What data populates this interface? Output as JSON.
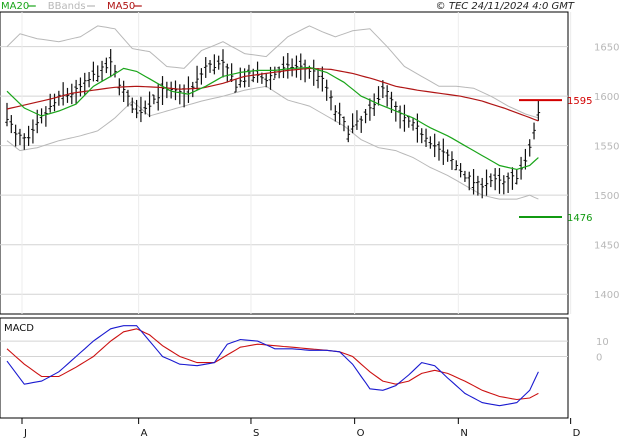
{
  "header": {
    "legend": [
      {
        "label": "MA20",
        "color": "#1aa51a"
      },
      {
        "label": "BBands",
        "color": "#b8b8b8"
      },
      {
        "label": "MA50",
        "color": "#b01515"
      }
    ],
    "credit": "© TEC 24/11/2024 4:0 GMT"
  },
  "chart_data": [
    {
      "type": "line",
      "name": "price",
      "ylim": [
        1380,
        1685
      ],
      "yticks": [
        1400,
        1450,
        1500,
        1550,
        1600,
        1650
      ],
      "xticks": [
        "J",
        "A",
        "S",
        "O",
        "N",
        "D"
      ],
      "xtick_index": [
        0,
        27,
        53,
        77,
        101,
        127
      ],
      "n_points": 128,
      "grid": true,
      "price_markers": [
        {
          "label": "1595",
          "value": 1596,
          "color": "#d20000"
        },
        {
          "label": "1476",
          "value": 1478,
          "color": "#119a11"
        }
      ],
      "price_keys": [
        [
          0,
          1580
        ],
        [
          2,
          1560
        ],
        [
          5,
          1555
        ],
        [
          8,
          1578
        ],
        [
          12,
          1598
        ],
        [
          16,
          1605
        ],
        [
          20,
          1620
        ],
        [
          24,
          1632
        ],
        [
          27,
          1605
        ],
        [
          30,
          1582
        ],
        [
          33,
          1593
        ],
        [
          36,
          1605
        ],
        [
          40,
          1603
        ],
        [
          43,
          1608
        ],
        [
          46,
          1630
        ],
        [
          50,
          1632
        ],
        [
          53,
          1612
        ],
        [
          56,
          1620
        ],
        [
          60,
          1618
        ],
        [
          63,
          1625
        ],
        [
          66,
          1630
        ],
        [
          69,
          1628
        ],
        [
          72,
          1622
        ],
        [
          74,
          1608
        ],
        [
          76,
          1585
        ],
        [
          79,
          1565
        ],
        [
          82,
          1575
        ],
        [
          85,
          1590
        ],
        [
          87,
          1610
        ],
        [
          89,
          1595
        ],
        [
          91,
          1580
        ],
        [
          94,
          1570
        ],
        [
          97,
          1560
        ],
        [
          100,
          1545
        ],
        [
          103,
          1535
        ],
        [
          106,
          1520
        ],
        [
          109,
          1510
        ],
        [
          112,
          1515
        ],
        [
          115,
          1512
        ],
        [
          118,
          1520
        ],
        [
          120,
          1532
        ],
        [
          123,
          1582
        ]
      ],
      "ma20_keys": [
        [
          0,
          1605
        ],
        [
          4,
          1588
        ],
        [
          8,
          1580
        ],
        [
          12,
          1585
        ],
        [
          16,
          1592
        ],
        [
          20,
          1610
        ],
        [
          24,
          1620
        ],
        [
          27,
          1628
        ],
        [
          30,
          1625
        ],
        [
          34,
          1615
        ],
        [
          38,
          1605
        ],
        [
          42,
          1602
        ],
        [
          46,
          1610
        ],
        [
          50,
          1620
        ],
        [
          54,
          1624
        ],
        [
          58,
          1626
        ],
        [
          62,
          1626
        ],
        [
          66,
          1628
        ],
        [
          70,
          1629
        ],
        [
          74,
          1624
        ],
        [
          78,
          1614
        ],
        [
          82,
          1600
        ],
        [
          86,
          1592
        ],
        [
          90,
          1585
        ],
        [
          94,
          1578
        ],
        [
          98,
          1568
        ],
        [
          102,
          1560
        ],
        [
          106,
          1550
        ],
        [
          110,
          1540
        ],
        [
          114,
          1530
        ],
        [
          118,
          1526
        ],
        [
          121,
          1530
        ],
        [
          123,
          1538
        ]
      ],
      "ma50_keys": [
        [
          0,
          1587
        ],
        [
          5,
          1592
        ],
        [
          10,
          1597
        ],
        [
          15,
          1603
        ],
        [
          20,
          1606
        ],
        [
          25,
          1609
        ],
        [
          30,
          1610
        ],
        [
          35,
          1609
        ],
        [
          40,
          1607
        ],
        [
          45,
          1608
        ],
        [
          50,
          1613
        ],
        [
          55,
          1620
        ],
        [
          60,
          1623
        ],
        [
          65,
          1626
        ],
        [
          70,
          1628
        ],
        [
          75,
          1627
        ],
        [
          80,
          1623
        ],
        [
          85,
          1617
        ],
        [
          90,
          1610
        ],
        [
          95,
          1606
        ],
        [
          100,
          1603
        ],
        [
          105,
          1600
        ],
        [
          110,
          1595
        ],
        [
          115,
          1588
        ],
        [
          120,
          1580
        ],
        [
          123,
          1575
        ]
      ],
      "bb_upper_keys": [
        [
          0,
          1650
        ],
        [
          3,
          1663
        ],
        [
          7,
          1658
        ],
        [
          12,
          1655
        ],
        [
          17,
          1660
        ],
        [
          21,
          1671
        ],
        [
          25,
          1668
        ],
        [
          29,
          1648
        ],
        [
          33,
          1645
        ],
        [
          37,
          1630
        ],
        [
          41,
          1628
        ],
        [
          45,
          1646
        ],
        [
          50,
          1655
        ],
        [
          55,
          1643
        ],
        [
          60,
          1640
        ],
        [
          65,
          1660
        ],
        [
          70,
          1671
        ],
        [
          73,
          1665
        ],
        [
          76,
          1660
        ],
        [
          80,
          1666
        ],
        [
          84,
          1668
        ],
        [
          88,
          1650
        ],
        [
          92,
          1630
        ],
        [
          96,
          1620
        ],
        [
          100,
          1610
        ],
        [
          104,
          1610
        ],
        [
          108,
          1608
        ],
        [
          112,
          1600
        ],
        [
          116,
          1590
        ],
        [
          120,
          1582
        ],
        [
          123,
          1578
        ]
      ],
      "bb_lower_keys": [
        [
          0,
          1555
        ],
        [
          3,
          1545
        ],
        [
          7,
          1548
        ],
        [
          12,
          1555
        ],
        [
          17,
          1560
        ],
        [
          21,
          1565
        ],
        [
          25,
          1578
        ],
        [
          29,
          1595
        ],
        [
          33,
          1580
        ],
        [
          37,
          1585
        ],
        [
          41,
          1590
        ],
        [
          45,
          1595
        ],
        [
          50,
          1600
        ],
        [
          55,
          1606
        ],
        [
          60,
          1610
        ],
        [
          65,
          1596
        ],
        [
          70,
          1590
        ],
        [
          74,
          1580
        ],
        [
          78,
          1570
        ],
        [
          82,
          1556
        ],
        [
          86,
          1548
        ],
        [
          90,
          1545
        ],
        [
          94,
          1538
        ],
        [
          98,
          1528
        ],
        [
          102,
          1520
        ],
        [
          106,
          1510
        ],
        [
          110,
          1500
        ],
        [
          114,
          1496
        ],
        [
          118,
          1496
        ],
        [
          121,
          1500
        ],
        [
          123,
          1496
        ]
      ]
    },
    {
      "type": "line",
      "name": "MACD",
      "title": "MACD",
      "ylim": [
        -40,
        25
      ],
      "yticks": [
        10,
        0
      ],
      "macd_keys": [
        [
          0,
          -3
        ],
        [
          4,
          -18
        ],
        [
          8,
          -16
        ],
        [
          12,
          -10
        ],
        [
          16,
          0
        ],
        [
          20,
          10
        ],
        [
          24,
          18
        ],
        [
          27,
          20
        ],
        [
          30,
          20
        ],
        [
          33,
          10
        ],
        [
          36,
          0
        ],
        [
          40,
          -5
        ],
        [
          44,
          -6
        ],
        [
          48,
          -4
        ],
        [
          51,
          8
        ],
        [
          54,
          11
        ],
        [
          58,
          10
        ],
        [
          62,
          5
        ],
        [
          66,
          5
        ],
        [
          70,
          4
        ],
        [
          74,
          4
        ],
        [
          77,
          3
        ],
        [
          80,
          -5
        ],
        [
          84,
          -21
        ],
        [
          87,
          -22
        ],
        [
          90,
          -19
        ],
        [
          93,
          -12
        ],
        [
          96,
          -4
        ],
        [
          99,
          -6
        ],
        [
          102,
          -14
        ],
        [
          106,
          -24
        ],
        [
          110,
          -30
        ],
        [
          114,
          -32
        ],
        [
          118,
          -30
        ],
        [
          121,
          -22
        ],
        [
          123,
          -10
        ]
      ],
      "signal_keys": [
        [
          0,
          5
        ],
        [
          4,
          -5
        ],
        [
          8,
          -13
        ],
        [
          12,
          -13
        ],
        [
          16,
          -7
        ],
        [
          20,
          0
        ],
        [
          24,
          10
        ],
        [
          27,
          16
        ],
        [
          30,
          18
        ],
        [
          33,
          14
        ],
        [
          36,
          7
        ],
        [
          40,
          0
        ],
        [
          44,
          -4
        ],
        [
          48,
          -4
        ],
        [
          51,
          1
        ],
        [
          54,
          6
        ],
        [
          58,
          8
        ],
        [
          62,
          7
        ],
        [
          66,
          6
        ],
        [
          70,
          5
        ],
        [
          74,
          4
        ],
        [
          77,
          3
        ],
        [
          80,
          0
        ],
        [
          84,
          -10
        ],
        [
          87,
          -16
        ],
        [
          90,
          -18
        ],
        [
          93,
          -16
        ],
        [
          96,
          -11
        ],
        [
          99,
          -9
        ],
        [
          102,
          -11
        ],
        [
          106,
          -16
        ],
        [
          110,
          -22
        ],
        [
          114,
          -26
        ],
        [
          118,
          -28
        ],
        [
          121,
          -27
        ],
        [
          123,
          -24
        ]
      ]
    }
  ]
}
